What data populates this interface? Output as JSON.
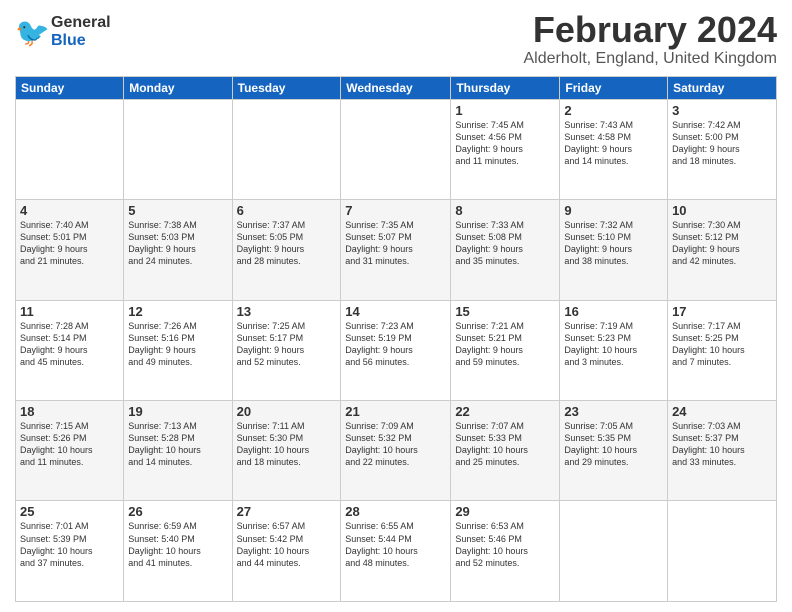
{
  "header": {
    "logo": {
      "general": "General",
      "blue": "Blue"
    },
    "title": "February 2024",
    "location": "Alderholt, England, United Kingdom"
  },
  "weekdays": [
    "Sunday",
    "Monday",
    "Tuesday",
    "Wednesday",
    "Thursday",
    "Friday",
    "Saturday"
  ],
  "weeks": [
    [
      {
        "day": "",
        "info": ""
      },
      {
        "day": "",
        "info": ""
      },
      {
        "day": "",
        "info": ""
      },
      {
        "day": "",
        "info": ""
      },
      {
        "day": "1",
        "info": "Sunrise: 7:45 AM\nSunset: 4:56 PM\nDaylight: 9 hours\nand 11 minutes."
      },
      {
        "day": "2",
        "info": "Sunrise: 7:43 AM\nSunset: 4:58 PM\nDaylight: 9 hours\nand 14 minutes."
      },
      {
        "day": "3",
        "info": "Sunrise: 7:42 AM\nSunset: 5:00 PM\nDaylight: 9 hours\nand 18 minutes."
      }
    ],
    [
      {
        "day": "4",
        "info": "Sunrise: 7:40 AM\nSunset: 5:01 PM\nDaylight: 9 hours\nand 21 minutes."
      },
      {
        "day": "5",
        "info": "Sunrise: 7:38 AM\nSunset: 5:03 PM\nDaylight: 9 hours\nand 24 minutes."
      },
      {
        "day": "6",
        "info": "Sunrise: 7:37 AM\nSunset: 5:05 PM\nDaylight: 9 hours\nand 28 minutes."
      },
      {
        "day": "7",
        "info": "Sunrise: 7:35 AM\nSunset: 5:07 PM\nDaylight: 9 hours\nand 31 minutes."
      },
      {
        "day": "8",
        "info": "Sunrise: 7:33 AM\nSunset: 5:08 PM\nDaylight: 9 hours\nand 35 minutes."
      },
      {
        "day": "9",
        "info": "Sunrise: 7:32 AM\nSunset: 5:10 PM\nDaylight: 9 hours\nand 38 minutes."
      },
      {
        "day": "10",
        "info": "Sunrise: 7:30 AM\nSunset: 5:12 PM\nDaylight: 9 hours\nand 42 minutes."
      }
    ],
    [
      {
        "day": "11",
        "info": "Sunrise: 7:28 AM\nSunset: 5:14 PM\nDaylight: 9 hours\nand 45 minutes."
      },
      {
        "day": "12",
        "info": "Sunrise: 7:26 AM\nSunset: 5:16 PM\nDaylight: 9 hours\nand 49 minutes."
      },
      {
        "day": "13",
        "info": "Sunrise: 7:25 AM\nSunset: 5:17 PM\nDaylight: 9 hours\nand 52 minutes."
      },
      {
        "day": "14",
        "info": "Sunrise: 7:23 AM\nSunset: 5:19 PM\nDaylight: 9 hours\nand 56 minutes."
      },
      {
        "day": "15",
        "info": "Sunrise: 7:21 AM\nSunset: 5:21 PM\nDaylight: 9 hours\nand 59 minutes."
      },
      {
        "day": "16",
        "info": "Sunrise: 7:19 AM\nSunset: 5:23 PM\nDaylight: 10 hours\nand 3 minutes."
      },
      {
        "day": "17",
        "info": "Sunrise: 7:17 AM\nSunset: 5:25 PM\nDaylight: 10 hours\nand 7 minutes."
      }
    ],
    [
      {
        "day": "18",
        "info": "Sunrise: 7:15 AM\nSunset: 5:26 PM\nDaylight: 10 hours\nand 11 minutes."
      },
      {
        "day": "19",
        "info": "Sunrise: 7:13 AM\nSunset: 5:28 PM\nDaylight: 10 hours\nand 14 minutes."
      },
      {
        "day": "20",
        "info": "Sunrise: 7:11 AM\nSunset: 5:30 PM\nDaylight: 10 hours\nand 18 minutes."
      },
      {
        "day": "21",
        "info": "Sunrise: 7:09 AM\nSunset: 5:32 PM\nDaylight: 10 hours\nand 22 minutes."
      },
      {
        "day": "22",
        "info": "Sunrise: 7:07 AM\nSunset: 5:33 PM\nDaylight: 10 hours\nand 25 minutes."
      },
      {
        "day": "23",
        "info": "Sunrise: 7:05 AM\nSunset: 5:35 PM\nDaylight: 10 hours\nand 29 minutes."
      },
      {
        "day": "24",
        "info": "Sunrise: 7:03 AM\nSunset: 5:37 PM\nDaylight: 10 hours\nand 33 minutes."
      }
    ],
    [
      {
        "day": "25",
        "info": "Sunrise: 7:01 AM\nSunset: 5:39 PM\nDaylight: 10 hours\nand 37 minutes."
      },
      {
        "day": "26",
        "info": "Sunrise: 6:59 AM\nSunset: 5:40 PM\nDaylight: 10 hours\nand 41 minutes."
      },
      {
        "day": "27",
        "info": "Sunrise: 6:57 AM\nSunset: 5:42 PM\nDaylight: 10 hours\nand 44 minutes."
      },
      {
        "day": "28",
        "info": "Sunrise: 6:55 AM\nSunset: 5:44 PM\nDaylight: 10 hours\nand 48 minutes."
      },
      {
        "day": "29",
        "info": "Sunrise: 6:53 AM\nSunset: 5:46 PM\nDaylight: 10 hours\nand 52 minutes."
      },
      {
        "day": "",
        "info": ""
      },
      {
        "day": "",
        "info": ""
      }
    ]
  ]
}
